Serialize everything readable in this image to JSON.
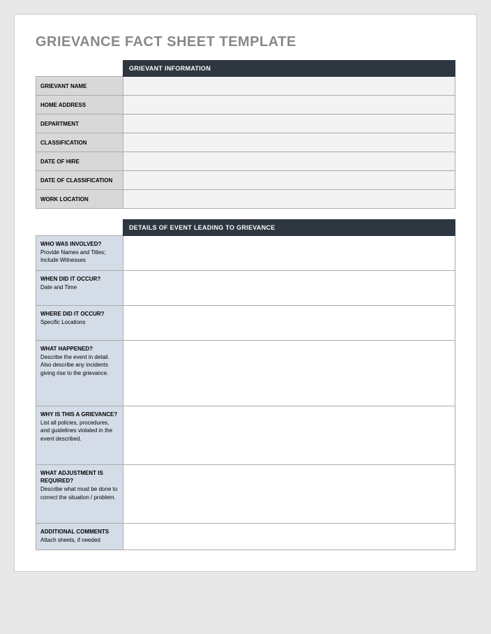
{
  "title": "GRIEVANCE FACT SHEET TEMPLATE",
  "section1": {
    "header": "GRIEVANT INFORMATION",
    "rows": [
      {
        "label": "GRIEVANT NAME",
        "value": ""
      },
      {
        "label": "HOME ADDRESS",
        "value": ""
      },
      {
        "label": "DEPARTMENT",
        "value": ""
      },
      {
        "label": "CLASSIFICATION",
        "value": ""
      },
      {
        "label": "DATE OF HIRE",
        "value": ""
      },
      {
        "label": "DATE OF CLASSIFICATION",
        "value": ""
      },
      {
        "label": "WORK LOCATION",
        "value": ""
      }
    ]
  },
  "section2": {
    "header": "DETAILS OF EVENT LEADING TO GRIEVANCE",
    "rows": [
      {
        "label": "WHO WAS INVOLVED?",
        "sub": "Provide Names and Titles; Include Witnesses",
        "value": "",
        "height": "h-sm"
      },
      {
        "label": "WHEN DID IT OCCUR?",
        "sub": "Date and Time",
        "value": "",
        "height": "h-sm"
      },
      {
        "label": "WHERE DID IT OCCUR?",
        "sub": "Specific Locations",
        "value": "",
        "height": "h-sm"
      },
      {
        "label": "WHAT HAPPENED?",
        "sub": "Describe the event in detail.  Also describe any incidents giving rise to the grievance.",
        "value": "",
        "height": "h-lg"
      },
      {
        "label": "WHY IS THIS A GRIEVANCE?",
        "sub": "List all policies, procedures, and guidelines violated in the event described.",
        "value": "",
        "height": "h-md"
      },
      {
        "label": "WHAT ADJUSTMENT IS REQUIRED?",
        "sub": "Describe what must be done to correct the situation / problem.",
        "value": "",
        "height": "h-md"
      },
      {
        "label": "ADDITIONAL COMMENTS",
        "sub": "Attach sheets, if needed",
        "value": "",
        "height": "h-xs"
      }
    ]
  }
}
